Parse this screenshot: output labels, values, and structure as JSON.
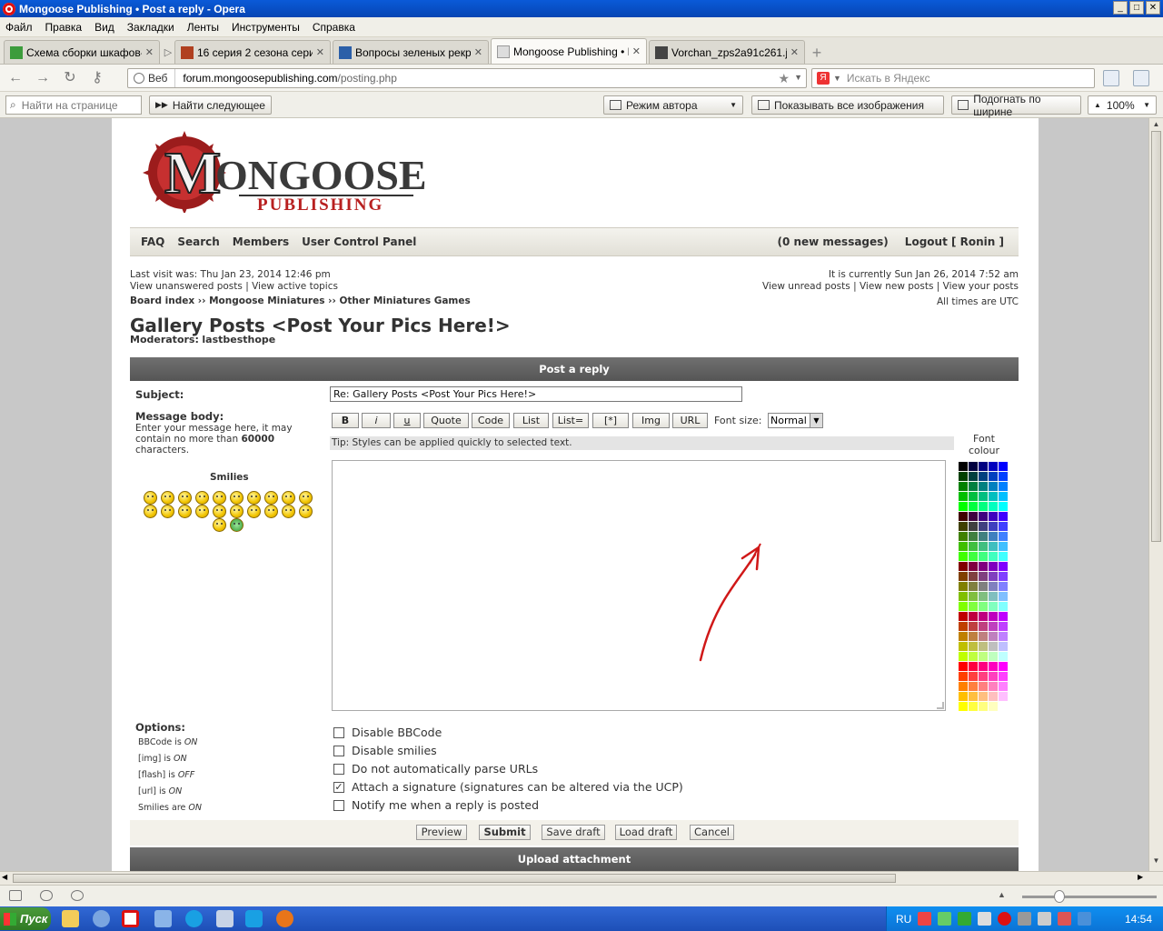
{
  "window": {
    "title": "Mongoose Publishing • Post a reply - Opera",
    "min": "_",
    "max": "□",
    "close": "✕"
  },
  "menu": [
    "Файл",
    "Правка",
    "Вид",
    "Закладки",
    "Ленты",
    "Инструменты",
    "Справка"
  ],
  "tabs": [
    {
      "label": "Схема сборки шкафов-...",
      "color": "#3c9c3c"
    },
    {
      "label": "16 серия 2 сезона сери...",
      "color": "#b04020"
    },
    {
      "label": "Вопросы зеленых рекр...",
      "color": "#2b5fa8"
    },
    {
      "label": "Mongoose Publishing • P...",
      "color": "#dddddd"
    },
    {
      "label": "Vorchan_zps2a91c261.j...",
      "color": "#444444"
    }
  ],
  "address": {
    "web_label": "Веб",
    "url_domain": "forum.mongoosepublishing.com",
    "url_path": "/posting.php",
    "search_placeholder": "Искать в Яндекс"
  },
  "findbar": {
    "find_placeholder": "Найти на странице",
    "find_next": "Найти следующее",
    "author_mode": "Режим автора",
    "show_images": "Показывать все изображения",
    "fit_width": "Подогнать по ширине",
    "zoom": "100%"
  },
  "forum": {
    "nav_left": [
      "FAQ",
      "Search",
      "Members",
      "User Control Panel"
    ],
    "new_messages": "(0 new messages)",
    "logout": "Logout [ Ronin ]",
    "last_visit": "Last visit was: Thu Jan 23, 2014 12:46 pm",
    "view_unanswered": "View unanswered posts",
    "view_active": "View active topics",
    "current_time": "It is currently Sun Jan 26, 2014 7:52 am",
    "view_unread": "View unread posts",
    "view_new": "View new posts",
    "view_your": "View your posts",
    "times_utc": "All times are UTC",
    "crumbs": [
      "Board index",
      "Mongoose Miniatures",
      "Other Miniatures Games"
    ],
    "crumb_sep": " ›› ",
    "title": "Gallery Posts <Post Your Pics Here!>",
    "moderators_label": "Moderators:",
    "moderator": "lastbesthope"
  },
  "form": {
    "header": "Post a reply",
    "subject_label": "Subject:",
    "subject_value": "Re: Gallery Posts <Post Your Pics Here!>",
    "body_label": "Message body:",
    "body_hint_1": "Enter your message here, it may",
    "body_hint_2": "contain no more than",
    "body_limit": "60000",
    "body_hint_3": "characters.",
    "smilies_label": "Smilies",
    "bbcode_buttons": [
      "B",
      "i",
      "u",
      "Quote",
      "Code",
      "List",
      "List=",
      "[*]",
      "Img",
      "URL"
    ],
    "font_size_label": "Font size:",
    "font_size_value": "Normal",
    "tip": "Tip: Styles can be applied quickly to selected text.",
    "font_colour_1": "Font",
    "font_colour_2": "colour",
    "options_label": "Options:",
    "options_status": [
      {
        "text": "BBCode is ",
        "state": "ON"
      },
      {
        "text": "[img] is ",
        "state": "ON"
      },
      {
        "text": "[flash] is ",
        "state": "OFF"
      },
      {
        "text": "[url] is ",
        "state": "ON"
      },
      {
        "text": "Smilies are ",
        "state": "ON"
      }
    ],
    "checkboxes": [
      {
        "label": "Disable BBCode",
        "checked": false
      },
      {
        "label": "Disable smilies",
        "checked": false
      },
      {
        "label": "Do not automatically parse URLs",
        "checked": false
      },
      {
        "label": "Attach a signature (signatures can be altered via the UCP)",
        "checked": true
      },
      {
        "label": "Notify me when a reply is posted",
        "checked": false
      }
    ],
    "actions": [
      "Preview",
      "Submit",
      "Save draft",
      "Load draft",
      "Cancel"
    ],
    "upload_header": "Upload attachment"
  },
  "taskbar": {
    "start": "Пуск",
    "lang": "RU",
    "clock": "14:54"
  },
  "colors": {
    "titlebar": "#0645b3",
    "header_bar": "#606060",
    "annotation": "#d01818"
  }
}
